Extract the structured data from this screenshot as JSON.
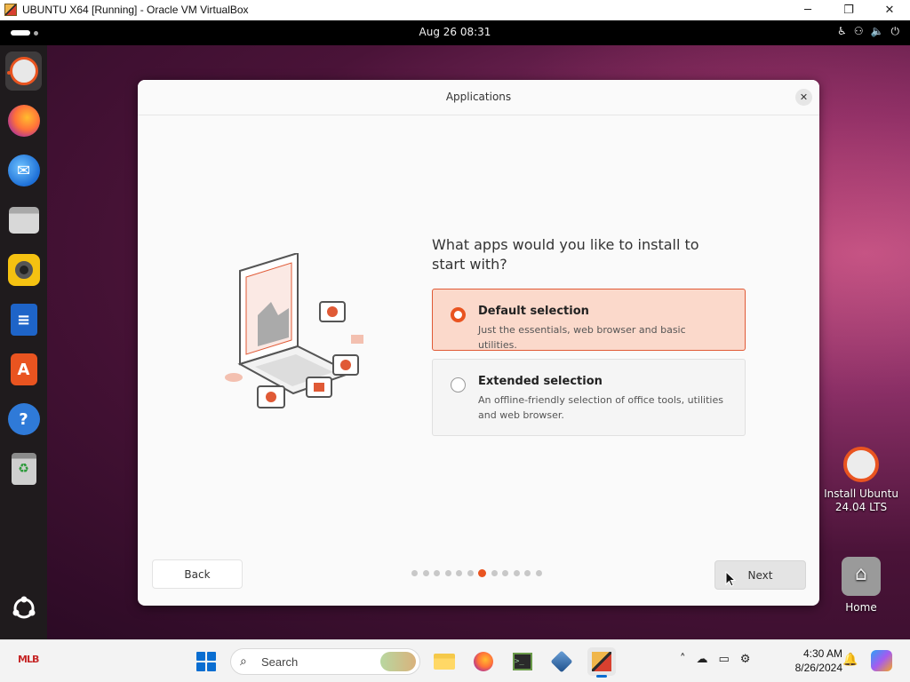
{
  "vbox": {
    "title": "UBUNTU X64 [Running] - Oracle VM VirtualBox",
    "controls": {
      "minimize": "─",
      "maximize": "❐",
      "close": "✕"
    }
  },
  "topbar": {
    "clock": "Aug 26  08:31",
    "tray_icons": [
      "accessibility-icon",
      "network-icon",
      "volume-icon",
      "power-icon"
    ]
  },
  "dock": {
    "items": [
      "ubuntu-installer-icon",
      "firefox-icon",
      "thunderbird-icon",
      "files-icon",
      "rhythmbox-icon",
      "writer-icon",
      "app-center-icon",
      "help-icon",
      "trash-icon",
      "show-apps-icon"
    ]
  },
  "desktop_icons": {
    "install": "Install Ubuntu\n24.04 LTS",
    "home": "Home"
  },
  "dialog": {
    "title": "Applications",
    "question": "What apps would you like to install to start with?",
    "options": [
      {
        "title": "Default selection",
        "desc": "Just the essentials, web browser and basic utilities.",
        "selected": true
      },
      {
        "title": "Extended selection",
        "desc": "An offline-friendly selection of office tools, utilities and web browser.",
        "selected": false
      }
    ],
    "back_label": "Back",
    "next_label": "Next",
    "pager": {
      "total": 12,
      "current": 7
    },
    "accent": "#e95420"
  },
  "taskbar": {
    "search_label": "Search",
    "time": "4:30 AM",
    "date": "8/26/2024",
    "apps": [
      "file-explorer-icon",
      "firefox-icon",
      "terminal-icon",
      "virtualbox-icon",
      "vm-window-icon"
    ]
  }
}
